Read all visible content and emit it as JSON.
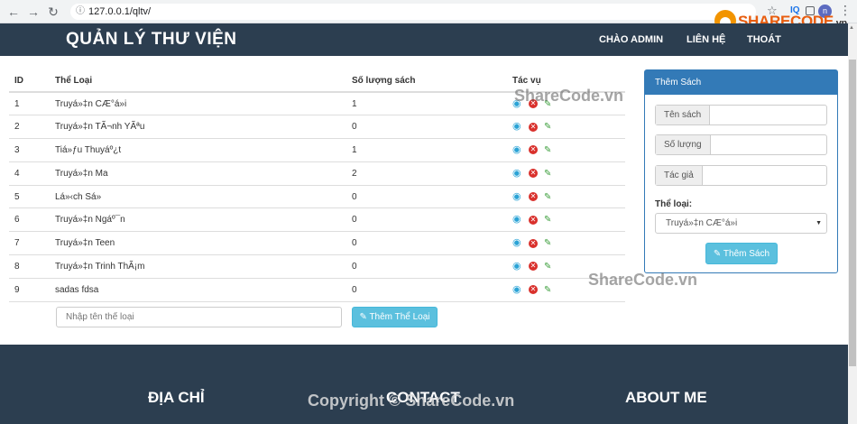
{
  "browser": {
    "url": "127.0.0.1/qltv/",
    "ext_label": "IQ",
    "profile_initial": "n"
  },
  "navbar": {
    "brand": "QUẢN LÝ THƯ VIỆN",
    "links": [
      "CHÀO ADMIN",
      "LIÊN HỆ",
      "THOÁT"
    ]
  },
  "table": {
    "headers": [
      "ID",
      "Thể Loại",
      "Số lượng sách",
      "Tác vụ"
    ],
    "rows": [
      {
        "id": "1",
        "name": "Truyá»‡n CÆ°á»i",
        "qty": "1"
      },
      {
        "id": "2",
        "name": "Truyá»‡n TÃ¬nh YÃªu",
        "qty": "0"
      },
      {
        "id": "3",
        "name": "Tiá»ƒu Thuyáº¿t",
        "qty": "1"
      },
      {
        "id": "4",
        "name": "Truyá»‡n Ma",
        "qty": "2"
      },
      {
        "id": "5",
        "name": "Lá»‹ch Sá»",
        "qty": "0"
      },
      {
        "id": "6",
        "name": "Truyá»‡n Ngáº¯n",
        "qty": "0"
      },
      {
        "id": "7",
        "name": "Truyá»‡n Teen",
        "qty": "0"
      },
      {
        "id": "8",
        "name": "Truyá»‡n Trinh ThÃ¡m",
        "qty": "0"
      },
      {
        "id": "9",
        "name": "sadas fdsa",
        "qty": "0"
      }
    ]
  },
  "add_category": {
    "placeholder": "Nhập tên thể loại",
    "button": "Thêm Thể Loại"
  },
  "panel": {
    "title": "Thêm Sách",
    "fields": {
      "book_name": {
        "label": "Tên sách",
        "value": ""
      },
      "quantity": {
        "label": "Số lượng",
        "value": ""
      },
      "author": {
        "label": "Tác giả",
        "value": ""
      }
    },
    "category_label": "Thể loại:",
    "category_selected": "Truyá»‡n CÆ°á»i",
    "submit": "Thêm Sách"
  },
  "footer": {
    "headings": [
      "ĐỊA CHỈ",
      "CONTACT",
      "ABOUT ME"
    ]
  },
  "watermarks": {
    "logo_brand": "SHARECODE",
    "logo_tld": ".vn",
    "mark": "ShareCode.vn",
    "copyright": "Copyright © ShareCode.vn"
  },
  "colors": {
    "navbar": "#2c3e50",
    "panel_primary": "#337ab7",
    "info_button": "#5bc0de",
    "delete": "#d9302c",
    "view": "#2aa3d6",
    "edit": "#3a9d3a"
  },
  "icons": {
    "view": "eye-icon",
    "delete": "times-circle-icon",
    "edit": "edit-icon"
  }
}
